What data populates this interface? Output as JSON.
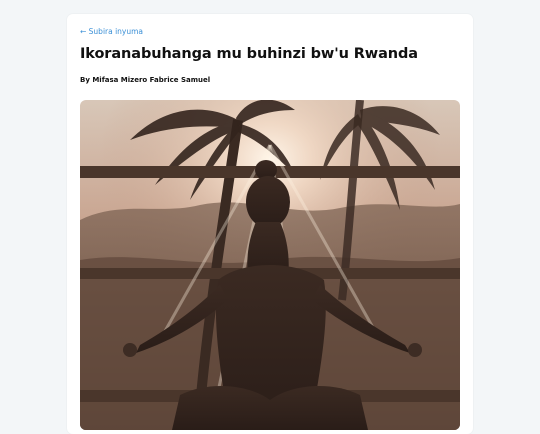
{
  "article": {
    "back_label": "← Subira inyuma",
    "title": "Ikoranabuhanga mu buhinzi bw'u Rwanda",
    "author": "By Mifasa Mizero Fabrice Samuel"
  },
  "hero_image": {
    "subject": "meditation-silhouette-photo"
  },
  "colors": {
    "background": "#f3f6f8",
    "card": "#ffffff",
    "link": "#3a8fd6",
    "text": "#111111"
  }
}
